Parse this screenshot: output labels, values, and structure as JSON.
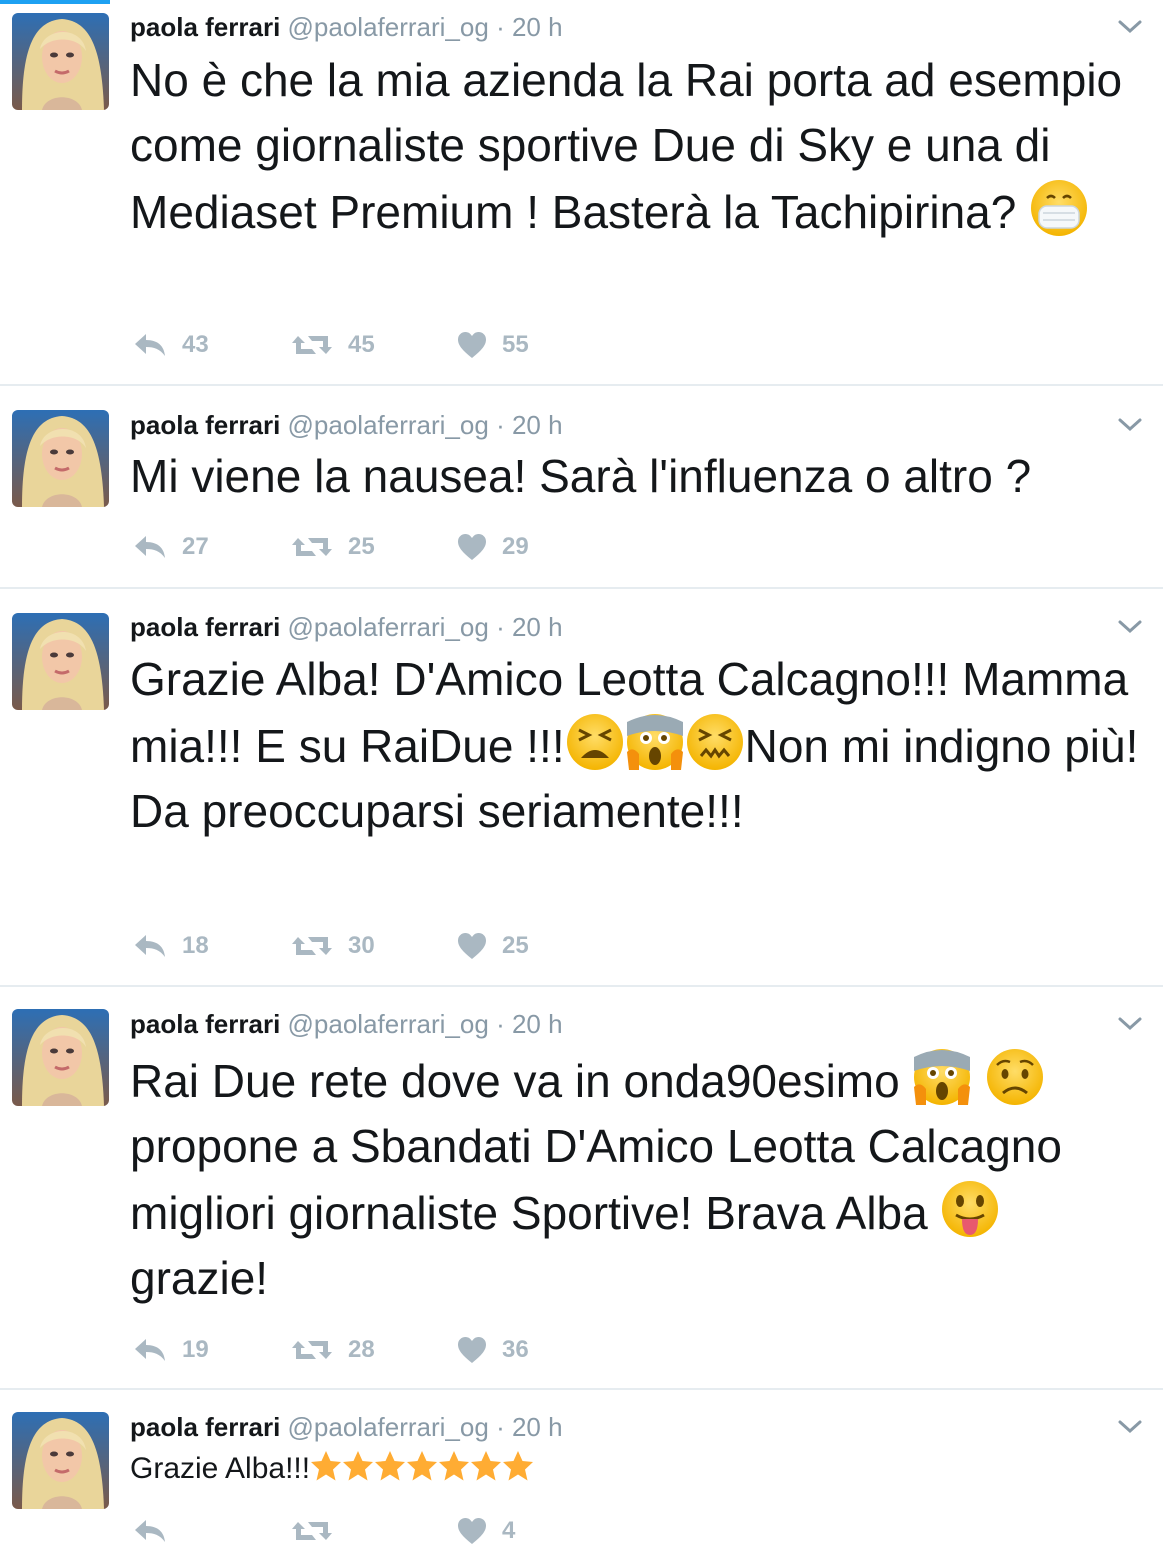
{
  "author": {
    "name": "paola ferrari",
    "handle": "@paolaferrari_og",
    "separator": "·"
  },
  "tweets": [
    {
      "time": "20 h",
      "text_parts": [
        "No è che la mia azienda la Rai porta ad esempio come giornaliste sportive Due di Sky e una di Mediaset Premium ! Basterà la Tachipirina?"
      ],
      "emoji": [
        "medical-mask-face"
      ],
      "replies": "43",
      "retweets": "45",
      "likes": "55"
    },
    {
      "time": "20 h",
      "text_parts": [
        "Mi viene la nausea! Sarà l'influenza o altro ?"
      ],
      "emoji": [],
      "replies": "27",
      "retweets": "25",
      "likes": "29"
    },
    {
      "time": "20 h",
      "text_parts": [
        "Grazie Alba! D'Amico Leotta Calcagno!!! Mamma mia!!! E su RaiDue !!!",
        "Non mi indigno più! Da preoccuparsi seriamente!!!"
      ],
      "emoji": [
        "tired-face",
        "screaming-face",
        "confounded-face"
      ],
      "replies": "18",
      "retweets": "30",
      "likes": "25"
    },
    {
      "time": "20 h",
      "text_parts": [
        "Rai Due rete dove va in onda90esimo",
        "propone a Sbandati D'Amico Leotta Calcagno migliori giornaliste Sportive! Brava Alba",
        "grazie!"
      ],
      "emoji": [
        "screaming-face",
        "worried-face",
        "tongue-face"
      ],
      "replies": "19",
      "retweets": "28",
      "likes": "36"
    },
    {
      "time": "20 h",
      "text_parts": [
        "Grazie Alba!!!"
      ],
      "emoji": [
        "star",
        "star",
        "star",
        "star",
        "star",
        "star",
        "star"
      ],
      "replies": "",
      "retweets": "",
      "likes": "4"
    }
  ],
  "colors": {
    "accent": "#1da1f2",
    "meta_gray": "#8899a6",
    "action_gray": "#aab8c2",
    "divider": "#e6ecf0",
    "emoji_yellow": "#ffcc4d",
    "star": "#ffac33"
  }
}
